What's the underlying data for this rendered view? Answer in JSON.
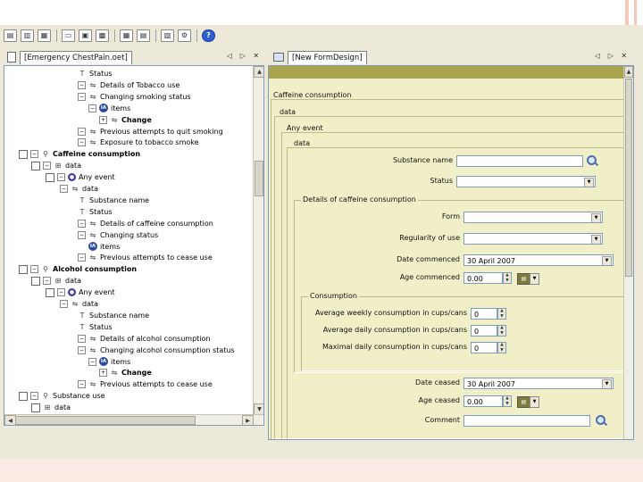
{
  "toolbar": {
    "icons": [
      "new-icon",
      "open-project-icon",
      "open-solution-icon",
      "open-file-icon",
      "save-icon",
      "save-all-icon",
      "build-icon",
      "properties-icon",
      "export-icon",
      "settings-icon",
      "help-icon"
    ],
    "help_label": "?"
  },
  "left_panel": {
    "tab_label": "[Emergency ChestPain.oet]",
    "controls": "◁ ▷ ✕"
  },
  "right_panel": {
    "tab_label": "[New FormDesign]",
    "controls": "◁ ▷ ✕"
  },
  "tree": [
    {
      "text": "Status",
      "icon": "T",
      "bold": false
    },
    {
      "text": "Details of Tobacco use",
      "icon": "⇋",
      "bold": false
    },
    {
      "text": "Changing smoking status",
      "icon": "⇋",
      "bold": false
    },
    {
      "text": "items",
      "icon": "items",
      "bold": false
    },
    {
      "text": "Change",
      "icon": "⇋",
      "bold": true
    },
    {
      "text": "Previous attempts to quit smoking",
      "icon": "⇋",
      "bold": false
    },
    {
      "text": "Exposure to tobacco smoke",
      "icon": "⇋",
      "bold": false
    },
    {
      "text": "Caffeine consumption",
      "icon": "⚲",
      "bold": true
    },
    {
      "text": "data",
      "icon": "⊞",
      "bold": false
    },
    {
      "text": "Any event",
      "icon": "event",
      "bold": false
    },
    {
      "text": "data",
      "icon": "⇋",
      "bold": false
    },
    {
      "text": "Substance name",
      "icon": "T",
      "bold": false
    },
    {
      "text": "Status",
      "icon": "T",
      "bold": false
    },
    {
      "text": "Details of caffeine consumption",
      "icon": "⇋",
      "bold": false
    },
    {
      "text": "Changing status",
      "icon": "⇋",
      "bold": false
    },
    {
      "text": "items",
      "icon": "items",
      "bold": false
    },
    {
      "text": "Previous attempts to cease use",
      "icon": "⇋",
      "bold": false
    },
    {
      "text": "Alcohol consumption",
      "icon": "⚲",
      "bold": true
    },
    {
      "text": "data",
      "icon": "⊞",
      "bold": false
    },
    {
      "text": "Any event",
      "icon": "event",
      "bold": false
    },
    {
      "text": "data",
      "icon": "⇋",
      "bold": false
    },
    {
      "text": "Substance name",
      "icon": "T",
      "bold": false
    },
    {
      "text": "Status",
      "icon": "T",
      "bold": false
    },
    {
      "text": "Details of alcohol consumption",
      "icon": "⇋",
      "bold": false
    },
    {
      "text": "Changing alcohol consumption status",
      "icon": "⇋",
      "bold": false
    },
    {
      "text": "items",
      "icon": "items",
      "bold": false
    },
    {
      "text": "Change",
      "icon": "⇋",
      "bold": true
    },
    {
      "text": "Previous attempts to cease use",
      "icon": "⇋",
      "bold": false
    },
    {
      "text": "Substance use",
      "icon": "⚲",
      "bold": false
    },
    {
      "text": "data",
      "icon": "⊞",
      "bold": false
    }
  ],
  "form": {
    "group_caffeine": "Caffeine consumption",
    "group_data": "data",
    "group_any_event": "Any event",
    "group_data_inner": "data",
    "substance_name_label": "Substance name",
    "substance_name_value": "",
    "status_label": "Status",
    "status_value": "",
    "group_details": "Details of caffeine consumption",
    "form_label": "Form",
    "form_value": "",
    "regularity_label": "Regularity of use",
    "regularity_value": "",
    "date_commenced_label": "Date commenced",
    "date_commenced_value": "30   April   2007",
    "age_commenced_label": "Age commenced",
    "age_commenced_value": "0.00",
    "group_consumption": "Consumption",
    "weekly_label": "Average weekly consumption in cups/cans",
    "weekly_value": "0",
    "daily_label": "Average daily consumption in cups/cans",
    "daily_value": "0",
    "max_daily_label": "Maximal daily consumption in cups/cans",
    "max_daily_value": "0",
    "date_ceased_label": "Date ceased",
    "date_ceased_value": "30   April   2007",
    "age_ceased_label": "Age ceased",
    "age_ceased_value": "0.00",
    "comment_label": "Comment",
    "comment_value": ""
  }
}
